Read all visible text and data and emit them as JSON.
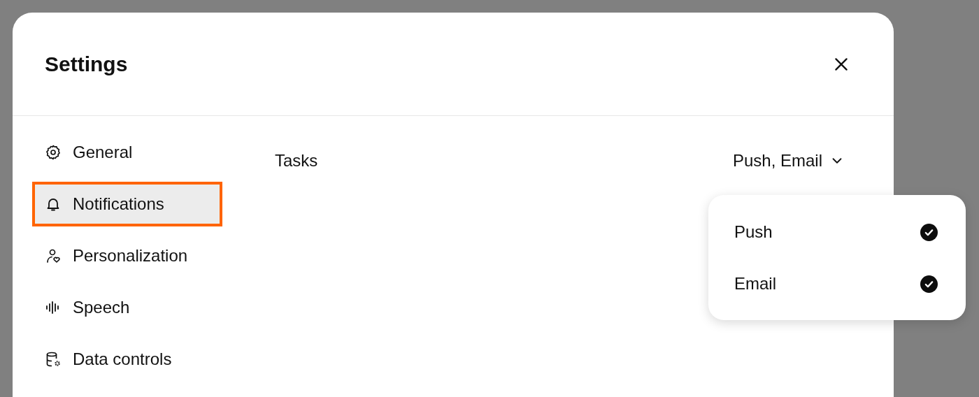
{
  "dialog": {
    "title": "Settings"
  },
  "sidebar": {
    "items": [
      {
        "label": "General",
        "selected": false,
        "highlighted": false
      },
      {
        "label": "Notifications",
        "selected": true,
        "highlighted": true
      },
      {
        "label": "Personalization",
        "selected": false,
        "highlighted": false
      },
      {
        "label": "Speech",
        "selected": false,
        "highlighted": false
      },
      {
        "label": "Data controls",
        "selected": false,
        "highlighted": false
      }
    ]
  },
  "settings": [
    {
      "label": "Tasks",
      "value": "Push, Email"
    }
  ],
  "menu": {
    "items": [
      {
        "label": "Push",
        "checked": true
      },
      {
        "label": "Email",
        "checked": true
      }
    ]
  }
}
